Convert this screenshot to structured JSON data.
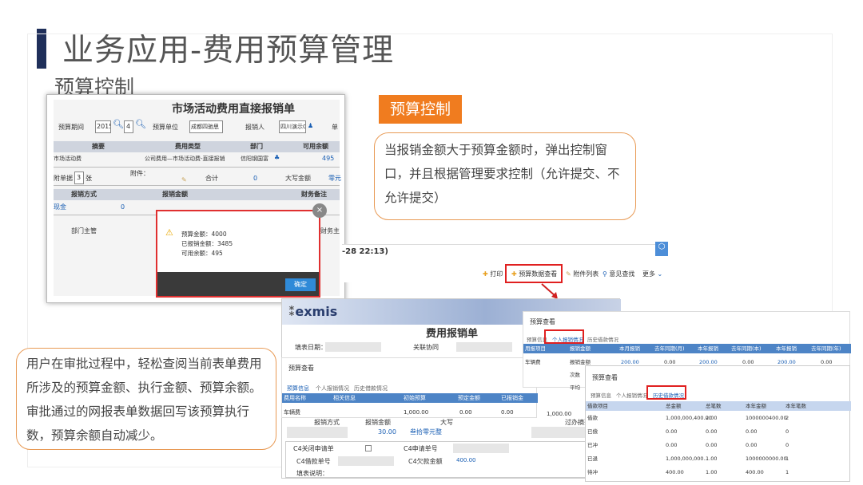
{
  "page": {
    "title": "业务应用-费用预算管理",
    "subtitle": "预算控制"
  },
  "tag": {
    "label": "预算控制"
  },
  "callout_right": "当报销金额大于预算金额时，弹出控制窗口，并且根据管理要求控制（允许提交、不允许提交）",
  "callout_left": "用户在审批过程中，轻松查阅当前表单费用所涉及的预算金额、执行金额、预算余额。审批通过的网报表单数据回写该预算执行数，预算余额自动减少。",
  "form1": {
    "title": "市场活动费用直接报销单",
    "fields": {
      "period_label": "预算期间",
      "period_year": "2015",
      "period_month": "4",
      "unit_label": "预算单位",
      "unit_value": "成都四驰思",
      "reporter_label": "报销人",
      "reporter_value": "四川演示01",
      "more": "单"
    },
    "grid_headers": [
      "摘要",
      "费用类型",
      "部门",
      "可用余额"
    ],
    "grid_row": [
      "市场活动费",
      "公司费用—市场活动费-直接报销",
      "信阳钢国富",
      "495"
    ],
    "attach_label": "附单据",
    "attach_count": "3",
    "attach_unit": "张",
    "attachment_label": "附件：",
    "total_label": "合计",
    "total_value": "0",
    "uppercase_label": "大写金额",
    "uppercase_value": "零元",
    "pay_headers": [
      "报销方式",
      "报销金额",
      "财务备注"
    ],
    "pay_row": [
      "现金",
      "0"
    ],
    "dept_label": "部门主管",
    "finance_label": "财务主",
    "dialog": {
      "l1": "预算金额：4000",
      "l2": "已报销金额：3485",
      "l3": "可用余额：495",
      "ok": "确定",
      "close": "×"
    }
  },
  "form2": {
    "datetime": "-28 22:13)",
    "toolbar": [
      "打印",
      "预算数据查看",
      "附件列表",
      "意见查找",
      "更多"
    ],
    "logo": "exmis",
    "title": "费用报销单",
    "fill_date_label": "填表日期：",
    "related_label": "关联协同",
    "pay_method": "报销方式",
    "pay_amount": "报销金额",
    "uppercase": "大写",
    "process": "过办摘要",
    "amount": "30.00",
    "amount_cn": "叁拾零元整",
    "c4_close": "C4关闭申请单",
    "c4_req": "C4申请单号",
    "c4_loan": "C4借款单号",
    "c4_due": "C4欠款金额",
    "c4_due_value": "400.00",
    "fill_desc": "填表说明："
  },
  "budget1": {
    "title": "预算查看",
    "tabs": [
      "预算信息",
      "个人报销情况",
      "历史借款情况"
    ],
    "headers": [
      "费用名称",
      "相关信息",
      "初始预算",
      "预定金额",
      "已报销金"
    ],
    "row": [
      "车辆费",
      "",
      "1,000.00",
      "0.00",
      "0.00"
    ],
    "extra_val": "1,000.00"
  },
  "budget2": {
    "title": "预算查看",
    "tabs": [
      "预算信息",
      "个人报销情况",
      "历史借款情况"
    ],
    "headers": [
      "用报项目",
      "报销金额",
      "本月报销",
      "去年同期(月)",
      "本年报销",
      "去年同期(本)",
      "本年报销",
      "去年同期(年)"
    ],
    "row": [
      "车辆费",
      "报销金额",
      "200.00",
      "0.00",
      "200.00",
      "0.00",
      "200.00",
      "0.00"
    ],
    "side": [
      "次数",
      "平均"
    ]
  },
  "budget3": {
    "title": "预算查看",
    "tabs": [
      "预算信息",
      "个人报销情况",
      "历史借款情况"
    ],
    "headers": [
      "借款项目",
      "总金额",
      "总笔数",
      "本年金额",
      "本年笔数"
    ],
    "rows": [
      [
        "借款",
        "1,000,000,400.00",
        "2.00",
        "1000000400.00",
        "2"
      ],
      [
        "已偿",
        "0.00",
        "0.00",
        "0.00",
        "0"
      ],
      [
        "已冲",
        "0.00",
        "0.00",
        "0.00",
        "0"
      ],
      [
        "已退",
        "1,000,000,000...",
        "1.00",
        "1000000000.00",
        "1"
      ],
      [
        "待冲",
        "400.00",
        "1.00",
        "400.00",
        "1"
      ]
    ]
  }
}
